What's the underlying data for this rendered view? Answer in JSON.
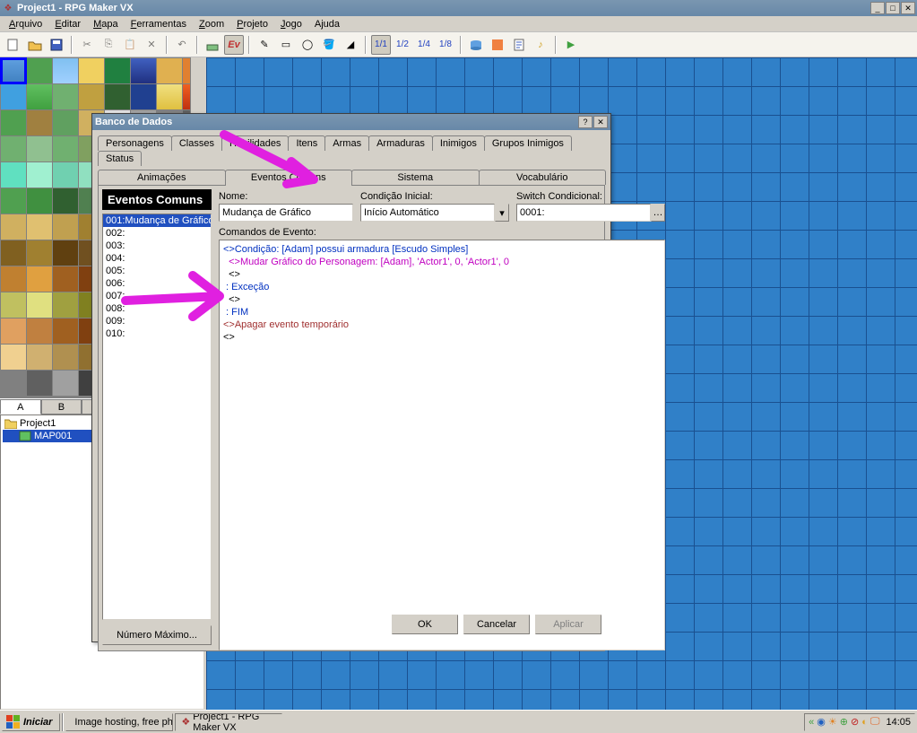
{
  "window": {
    "title": "Project1 - RPG Maker VX"
  },
  "menu": {
    "arquivo": "Arquivo",
    "editar": "Editar",
    "mapa": "Mapa",
    "ferramentas": "Ferramentas",
    "zoom": "Zoom",
    "projeto": "Projeto",
    "jogo": "Jogo",
    "ajuda": "Ajuda"
  },
  "zoom_labels": {
    "z1": "1/1",
    "z2": "1/2",
    "z4": "1/4",
    "z8": "1/8"
  },
  "ab_tabs": {
    "a": "A",
    "b": "B"
  },
  "tree": {
    "root": "Project1",
    "map": "MAP001"
  },
  "dialog": {
    "title": "Banco de Dados",
    "tabs_top": {
      "personagens": "Personagens",
      "classes": "Classes",
      "habilidades": "Habilidades",
      "itens": "Itens",
      "armas": "Armas",
      "armaduras": "Armaduras",
      "inimigos": "Inimigos",
      "grupos": "Grupos Inimigos",
      "status": "Status"
    },
    "tabs_bottom": {
      "animacoes": "Animações",
      "eventos": "Eventos Comuns",
      "sistema": "Sistema",
      "vocabulario": "Vocabulário"
    },
    "section_title": "Eventos Comuns",
    "list": [
      "001:Mudança de Gráfico",
      "002:",
      "003:",
      "004:",
      "005:",
      "006:",
      "007:",
      "008:",
      "009:",
      "010:"
    ],
    "max_btn": "Número Máximo...",
    "fields": {
      "nome_label": "Nome:",
      "nome_value": "Mudança de Gráfico",
      "cond_label": "Condição Inicial:",
      "cond_value": "Início Automático",
      "switch_label": "Switch Condicional:",
      "switch_value": "0001:"
    },
    "commands_label": "Comandos de Evento:",
    "commands": {
      "l1": "<>Condição: [Adam] possui armadura [Escudo Simples]",
      "l2": "  <>Mudar Gráfico do Personagem: [Adam], 'Actor1', 0, 'Actor1', 0",
      "l3": "  <>",
      "l4": " : Exceção",
      "l5": "  <>",
      "l6": " : FIM",
      "l7": "<>Apagar evento temporário",
      "l8": "<>"
    },
    "buttons": {
      "ok": "OK",
      "cancelar": "Cancelar",
      "aplicar": "Aplicar"
    }
  },
  "taskbar": {
    "start": "Iniciar",
    "task1": "Image hosting, free phot...",
    "task2": "Project1 - RPG Maker VX",
    "clock": "14:05"
  }
}
